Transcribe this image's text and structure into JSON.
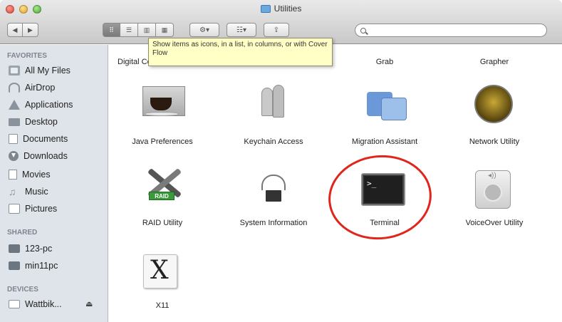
{
  "window": {
    "title": "Utilities"
  },
  "toolbar": {
    "back_glyph": "◀",
    "forward_glyph": "▶",
    "view_icons": "⠿",
    "view_list": "☰",
    "view_columns": "▥",
    "view_coverflow": "▦",
    "action_label": "⚙▾",
    "arrange_label": "☷▾",
    "share_label": "⇪",
    "search_placeholder": ""
  },
  "tooltip": {
    "text": "Show items as icons, in a list, in columns, or with Cover Flow"
  },
  "sidebar": {
    "favorites_header": "FAVORITES",
    "shared_header": "SHARED",
    "devices_header": "DEVICES",
    "favorites": [
      {
        "label": "All My Files",
        "icon": "all-my-files-icon"
      },
      {
        "label": "AirDrop",
        "icon": "airdrop-icon"
      },
      {
        "label": "Applications",
        "icon": "applications-icon"
      },
      {
        "label": "Desktop",
        "icon": "desktop-icon"
      },
      {
        "label": "Documents",
        "icon": "documents-icon"
      },
      {
        "label": "Downloads",
        "icon": "downloads-icon"
      },
      {
        "label": "Movies",
        "icon": "movies-icon"
      },
      {
        "label": "Music",
        "icon": "music-icon"
      },
      {
        "label": "Pictures",
        "icon": "pictures-icon"
      }
    ],
    "shared": [
      {
        "label": "123-pc",
        "icon": "pc-icon"
      },
      {
        "label": "min11pc",
        "icon": "pc-icon"
      }
    ],
    "devices": [
      {
        "label": "Wattbik...",
        "icon": "disk-icon",
        "eject": "⏏"
      }
    ]
  },
  "grid": {
    "top_row": [
      {
        "label": "Digital Color Meter"
      },
      {
        "label": "Grab"
      },
      {
        "label": "Grapher"
      }
    ],
    "items": [
      {
        "label": "Java Preferences",
        "icon": "java-preferences-icon"
      },
      {
        "label": "Keychain Access",
        "icon": "keychain-access-icon"
      },
      {
        "label": "Migration Assistant",
        "icon": "migration-assistant-icon"
      },
      {
        "label": "Network Utility",
        "icon": "network-utility-icon"
      },
      {
        "label": "RAID Utility",
        "icon": "raid-utility-icon"
      },
      {
        "label": "System Information",
        "icon": "system-information-icon"
      },
      {
        "label": "Terminal",
        "icon": "terminal-icon",
        "prompt": ">_"
      },
      {
        "label": "VoiceOver Utility",
        "icon": "voiceover-utility-icon"
      },
      {
        "label": "X11",
        "icon": "x11-icon",
        "glyph": "X"
      }
    ],
    "raid_tag": "RAID"
  },
  "colors": {
    "annotation": "#e0251c",
    "tooltip_bg": "#ffffc6",
    "sidebar_bg": "#dfe4ea"
  }
}
